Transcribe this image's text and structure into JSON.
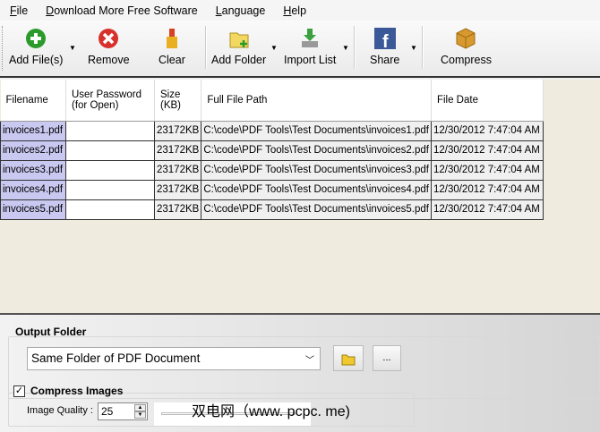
{
  "menu": [
    "File",
    "Download More Free Software",
    "Language",
    "Help"
  ],
  "toolbar": {
    "add_files": "Add File(s)",
    "remove": "Remove",
    "clear": "Clear",
    "add_folder": "Add Folder",
    "import_list": "Import List",
    "share": "Share",
    "compress": "Compress"
  },
  "table": {
    "headers": [
      "Filename",
      "User Password (for Open)",
      "Size (KB)",
      "Full File Path",
      "File Date"
    ],
    "rows": [
      [
        "invoices1.pdf",
        "",
        "23172KB",
        "C:\\code\\PDF Tools\\Test Documents\\invoices1.pdf",
        "12/30/2012 7:47:04 AM"
      ],
      [
        "invoices2.pdf",
        "",
        "23172KB",
        "C:\\code\\PDF Tools\\Test Documents\\invoices2.pdf",
        "12/30/2012 7:47:04 AM"
      ],
      [
        "invoices3.pdf",
        "",
        "23172KB",
        "C:\\code\\PDF Tools\\Test Documents\\invoices3.pdf",
        "12/30/2012 7:47:04 AM"
      ],
      [
        "invoices4.pdf",
        "",
        "23172KB",
        "C:\\code\\PDF Tools\\Test Documents\\invoices4.pdf",
        "12/30/2012 7:47:04 AM"
      ],
      [
        "invoices5.pdf",
        "",
        "23172KB",
        "C:\\code\\PDF Tools\\Test Documents\\invoices5.pdf",
        "12/30/2012 7:47:04 AM"
      ]
    ]
  },
  "output": {
    "title": "Output Folder",
    "folder": "Same Folder of PDF Document",
    "browse": "..."
  },
  "compress": {
    "label": "Compress Images",
    "checked": true,
    "quality_label": "Image Quality :",
    "quality": "25"
  },
  "watermark": "双电网（www. pcpc. me)"
}
